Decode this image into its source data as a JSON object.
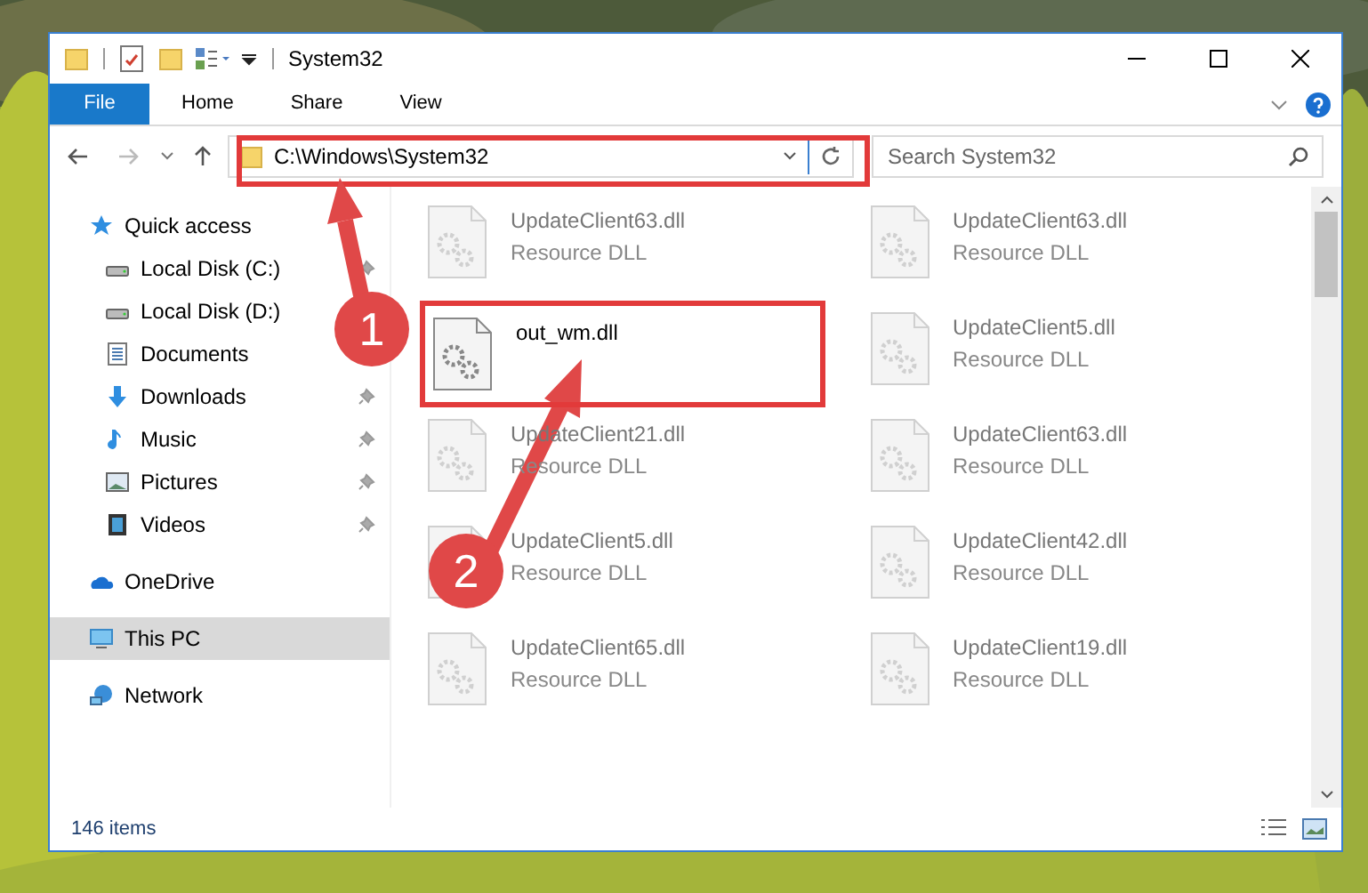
{
  "window": {
    "title": "System32"
  },
  "ribbon_tabs": [
    {
      "label": "File",
      "kind": "file"
    },
    {
      "label": "Home",
      "kind": "tab"
    },
    {
      "label": "Share",
      "kind": "tab"
    },
    {
      "label": "View",
      "kind": "tab"
    }
  ],
  "address_bar": {
    "path": "C:\\Windows\\System32"
  },
  "search": {
    "placeholder": "Search System32"
  },
  "nav_pane": [
    {
      "label": "Quick access",
      "kind": "star",
      "selected": false,
      "pinned": false,
      "children": [
        {
          "label": "Local Disk (C:)",
          "kind": "disk",
          "selected": false,
          "pinned": true
        },
        {
          "label": "Local Disk (D:)",
          "kind": "disk",
          "selected": false,
          "pinned": false
        },
        {
          "label": "Documents",
          "kind": "document",
          "selected": false,
          "pinned": false
        },
        {
          "label": "Downloads",
          "kind": "download",
          "selected": false,
          "pinned": true
        },
        {
          "label": "Music",
          "kind": "music",
          "selected": false,
          "pinned": true
        },
        {
          "label": "Pictures",
          "kind": "pictures",
          "selected": false,
          "pinned": true
        },
        {
          "label": "Videos",
          "kind": "videos",
          "selected": false,
          "pinned": true
        }
      ]
    },
    {
      "label": "OneDrive",
      "kind": "cloud",
      "selected": false,
      "pinned": false
    },
    {
      "label": "This PC",
      "kind": "pc",
      "selected": true,
      "pinned": false
    },
    {
      "label": "Network",
      "kind": "network",
      "selected": false,
      "pinned": false
    }
  ],
  "files": [
    {
      "name": "UpdateClient63.dll",
      "type": "Resource DLL",
      "dimmed": true,
      "highlighted": false
    },
    {
      "name": "UpdateClient63.dll",
      "type": "Resource DLL",
      "dimmed": true,
      "highlighted": false
    },
    {
      "name": "out_wm.dll",
      "dimmed": false,
      "highlighted": true
    },
    {
      "name": "UpdateClient5.dll",
      "type": "Resource DLL",
      "dimmed": true,
      "highlighted": false
    },
    {
      "name": "UpdateClient21.dll",
      "type": "Resource DLL",
      "dimmed": true,
      "highlighted": false
    },
    {
      "name": "UpdateClient63.dll",
      "type": "Resource DLL",
      "dimmed": true,
      "highlighted": false
    },
    {
      "name": "UpdateClient5.dll",
      "type": "Resource DLL",
      "dimmed": true,
      "highlighted": false
    },
    {
      "name": "UpdateClient42.dll",
      "type": "Resource DLL",
      "dimmed": true,
      "highlighted": false
    },
    {
      "name": "UpdateClient65.dll",
      "type": "Resource DLL",
      "dimmed": true,
      "highlighted": false
    },
    {
      "name": "UpdateClient19.dll",
      "type": "Resource DLL",
      "dimmed": true,
      "highlighted": false
    }
  ],
  "status_bar": {
    "item_count": "146 items"
  },
  "annotations": [
    {
      "number": "1"
    },
    {
      "number": "2"
    }
  ]
}
